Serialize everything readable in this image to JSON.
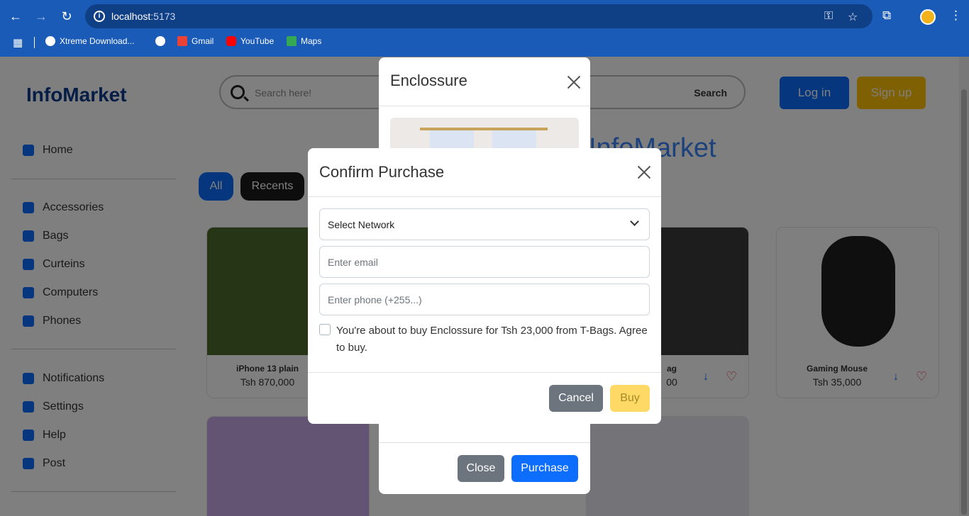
{
  "browser": {
    "url_host": "localhost",
    "url_port": ":5173",
    "bookmarks": [
      {
        "label": "Xtreme Download..."
      },
      {
        "label": ""
      },
      {
        "label": "Gmail"
      },
      {
        "label": "YouTube"
      },
      {
        "label": "Maps"
      }
    ]
  },
  "header": {
    "logo": "InfoMarket",
    "search_placeholder": "Search here!",
    "search_button": "Search",
    "login": "Log in",
    "signup": "Sign up",
    "hero": "InfoMarket"
  },
  "sidebar": {
    "items": [
      {
        "label": "Home"
      },
      {
        "label": "Accessories"
      },
      {
        "label": "Bags"
      },
      {
        "label": "Curteins"
      },
      {
        "label": "Computers"
      },
      {
        "label": "Phones"
      },
      {
        "label": "Notifications"
      },
      {
        "label": "Settings"
      },
      {
        "label": "Help"
      },
      {
        "label": "Post"
      }
    ]
  },
  "filters": {
    "all": "All",
    "recents": "Recents"
  },
  "products": [
    {
      "name": "iPhone 13 plain",
      "price": "Tsh 870,000"
    },
    {
      "name": "ag",
      "price": "00"
    },
    {
      "name": "Gaming Mouse",
      "price": "Tsh 35,000"
    }
  ],
  "enclosure_modal": {
    "title": "Enclossure",
    "close": "Close",
    "purchase": "Purchase"
  },
  "confirm_modal": {
    "title": "Confirm Purchase",
    "network_value": "Select Network",
    "email_placeholder": "Enter email",
    "phone_placeholder": "Enter phone (+255...)",
    "agree_text": "You're about to buy Enclossure for Tsh 23,000 from T-Bags. Agree to buy.",
    "cancel": "Cancel",
    "buy": "Buy"
  },
  "colors": {
    "chrome": "#1a5bb8",
    "primary": "#0d6efd",
    "warning": "#ffc107",
    "secondary": "#6c757d"
  }
}
